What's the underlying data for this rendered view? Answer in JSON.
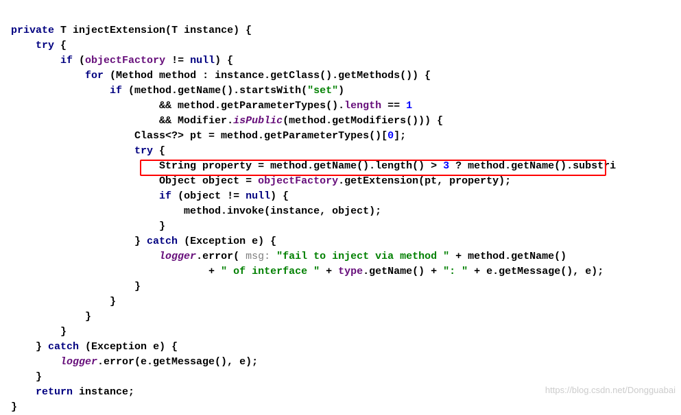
{
  "code": {
    "l1": {
      "a": "private ",
      "b": "T ",
      "c": "injectExtension(",
      "d": "T ",
      "e": "instance) {"
    },
    "l2": {
      "a": "try ",
      "b": "{"
    },
    "l3": {
      "a": "if ",
      "b": "(",
      "c": "objectFactory ",
      "d": "!= ",
      "e": "null",
      "f": ") {"
    },
    "l4": {
      "a": "for ",
      "b": "(Method method : instance.getClass().getMethods()) {"
    },
    "l5": {
      "a": "if ",
      "b": "(method.getName().startsWith(",
      "c": "\"set\"",
      "d": ")"
    },
    "l6": {
      "a": "&& method.getParameterTypes().",
      "b": "length ",
      "c": "== ",
      "d": "1"
    },
    "l7": {
      "a": "&& Modifier.",
      "b": "isPublic",
      "c": "(method.getModifiers())) {"
    },
    "l8": {
      "a": "Class<?> pt = method.getParameterTypes()[",
      "b": "0",
      "c": "];"
    },
    "l9": {
      "a": "try ",
      "b": "{"
    },
    "l10": {
      "a": "String property = method.getName().length() > ",
      "b": "3 ",
      "c": "? method.getName().substri"
    },
    "l11": {
      "a": "Object object = ",
      "b": "objectFactory",
      "c": ".getExtension(pt, property);"
    },
    "l12": {
      "a": "if ",
      "b": "(object != ",
      "c": "null",
      "d": ") {"
    },
    "l13": {
      "a": "method.invoke(instance, object);"
    },
    "l14": {
      "a": "}"
    },
    "l15": {
      "a": "} ",
      "b": "catch ",
      "c": "(Exception e) {"
    },
    "l16": {
      "a": "logger",
      "b": ".error(",
      "c": " msg: ",
      "d": "\"fail to inject via method \" ",
      "e": "+ method.getName()"
    },
    "l17": {
      "a": "+ ",
      "b": "\" of interface \" ",
      "c": "+ ",
      "d": "type",
      "e": ".getName() + ",
      "f": "\": \" ",
      "g": "+ e.getMessage(), e);"
    },
    "l18": {
      "a": "}"
    },
    "l19": {
      "a": "}"
    },
    "l20": {
      "a": "}"
    },
    "l21": {
      "a": "}"
    },
    "l22": {
      "a": "} ",
      "b": "catch ",
      "c": "(Exception e) {"
    },
    "l23": {
      "a": "logger",
      "b": ".error(e.getMessage(), e);"
    },
    "l24": {
      "a": "}"
    },
    "l25": {
      "a": "return ",
      "b": "instance;"
    },
    "l26": {
      "a": "}"
    }
  },
  "watermark": "https://blog.csdn.net/Dongguabai"
}
